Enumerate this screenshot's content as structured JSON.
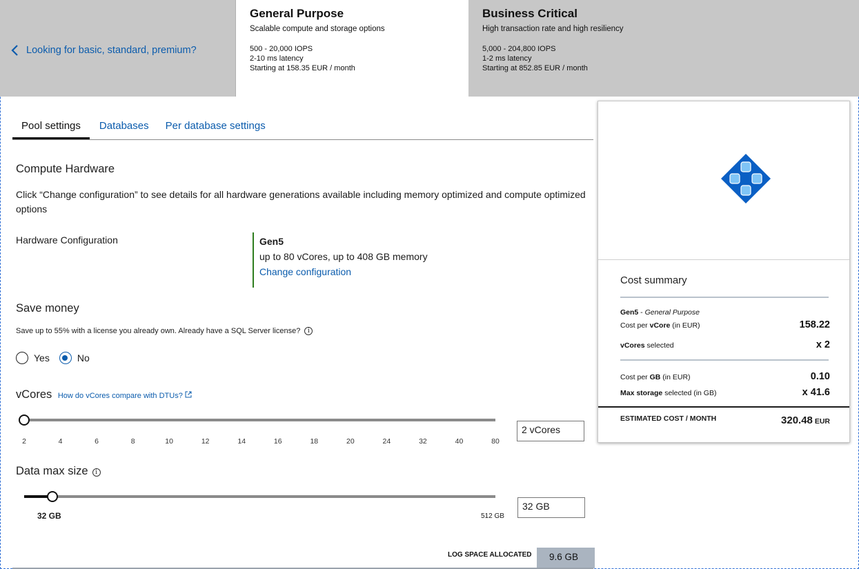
{
  "tiers": {
    "back_link": "Looking for basic, standard, premium?",
    "general_purpose": {
      "title": "General Purpose",
      "subtitle": "Scalable compute and storage options",
      "iops": "500 - 20,000 IOPS",
      "latency": "2-10 ms latency",
      "price": "Starting at 158.35 EUR / month"
    },
    "business_critical": {
      "title": "Business Critical",
      "subtitle": "High transaction rate and high resiliency",
      "iops": "5,000 - 204,800 IOPS",
      "latency": "1-2 ms latency",
      "price": "Starting at 852.85 EUR / month"
    }
  },
  "tabs": [
    {
      "label": "Pool settings",
      "active": true
    },
    {
      "label": "Databases",
      "active": false
    },
    {
      "label": "Per database settings",
      "active": false
    }
  ],
  "compute": {
    "heading": "Compute Hardware",
    "description": "Click “Change configuration” to see details for all hardware generations available including memory optimized and compute optimized options",
    "hw_label": "Hardware Configuration",
    "hw_gen": "Gen5",
    "hw_desc": "up to 80 vCores, up to 408 GB memory",
    "hw_link": "Change configuration"
  },
  "save_money": {
    "heading": "Save money",
    "description": "Save up to 55% with a license you already own. Already have a SQL Server license?",
    "options": [
      "Yes",
      "No"
    ],
    "selected": "No"
  },
  "vcores": {
    "heading": "vCores",
    "link": "How do vCores compare with DTUs?",
    "ticks": [
      "2",
      "4",
      "6",
      "8",
      "10",
      "12",
      "14",
      "16",
      "18",
      "20",
      "24",
      "32",
      "40",
      "80"
    ],
    "value": "2 vCores",
    "selected_index": 0
  },
  "data_max_size": {
    "heading": "Data max size",
    "min_label": "32 GB",
    "max_label": "512 GB",
    "value": "32 GB",
    "fraction": 0.06
  },
  "log_space": {
    "label": "LOG SPACE ALLOCATED",
    "value": "9.6 GB"
  },
  "cost_summary": {
    "title": "Cost summary",
    "gen": "Gen5",
    "tier": "General Purpose",
    "cost_per_vcore_pre": "Cost per ",
    "cost_per_vcore_bold": "vCore",
    "cost_per_vcore_post": " (in EUR)",
    "cost_per_vcore_value": "158.22",
    "vcores_bold": "vCores",
    "vcores_post": " selected",
    "vcores_value": "x 2",
    "cost_per_gb_pre": "Cost per ",
    "cost_per_gb_bold": "GB",
    "cost_per_gb_post": " (in EUR)",
    "cost_per_gb_value": "0.10",
    "max_storage_bold": "Max storage",
    "max_storage_post": " selected (in GB)",
    "max_storage_value": "x 41.6",
    "total_label": "ESTIMATED COST / MONTH",
    "total_value": "320.48",
    "total_currency": "EUR"
  },
  "colors": {
    "link": "#0b5cad",
    "tier_inactive_bg": "#c7c7c7",
    "hw_accent": "#2e7d1e",
    "log_bg": "#aab4c0",
    "db_icon": "#0a5fc4"
  }
}
